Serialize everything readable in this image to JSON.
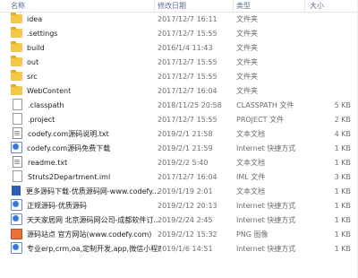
{
  "header": {
    "name": "名称",
    "date": "修改日期",
    "type": "类型",
    "size": "大小"
  },
  "files": [
    {
      "name": "idea",
      "date": "2017/12/7 16:11",
      "type": "文件夹",
      "size": "",
      "icon": "folder-icon"
    },
    {
      "name": ".settings",
      "date": "2017/12/7 15:55",
      "type": "文件夹",
      "size": "",
      "icon": "folder-icon"
    },
    {
      "name": "build",
      "date": "2016/1/4 11:43",
      "type": "文件夹",
      "size": "",
      "icon": "folder-icon"
    },
    {
      "name": "out",
      "date": "2017/12/7 15:55",
      "type": "文件夹",
      "size": "",
      "icon": "folder-icon"
    },
    {
      "name": "src",
      "date": "2017/12/7 15:55",
      "type": "文件夹",
      "size": "",
      "icon": "folder-icon"
    },
    {
      "name": "WebContent",
      "date": "2017/12/7 16:04",
      "type": "文件夹",
      "size": "",
      "icon": "folder-icon"
    },
    {
      "name": ".classpath",
      "date": "2018/11/25 20:58",
      "type": "CLASSPATH 文件",
      "size": "5 KB",
      "icon": "file-icon"
    },
    {
      "name": ".project",
      "date": "2017/12/7 15:55",
      "type": "PROJECT 文件",
      "size": "2 KB",
      "icon": "file-icon"
    },
    {
      "name": "codefy.com源码说明.txt",
      "date": "2019/2/1 21:58",
      "type": "文本文档",
      "size": "4 KB",
      "icon": "txt-icon"
    },
    {
      "name": "codefy.com源码免费下载",
      "date": "2019/2/1 21:59",
      "type": "Internet 快捷方式",
      "size": "1 KB",
      "icon": "web-icon"
    },
    {
      "name": "readme.txt",
      "date": "2019/2/2 5:40",
      "type": "文本文档",
      "size": "1 KB",
      "icon": "txt-icon"
    },
    {
      "name": "Struts2Department.iml",
      "date": "2017/12/7 16:04",
      "type": "IML 文件",
      "size": "3 KB",
      "icon": "file-icon"
    },
    {
      "name": "更多源码下载-优质源码网-www.codefy...",
      "date": "2019/1/19 2:01",
      "type": "文本文档",
      "size": "1 KB",
      "icon": "doc-icon"
    },
    {
      "name": "正规源码-优质源码",
      "date": "2019/2/12 20:13",
      "type": "Internet 快捷方式",
      "size": "1 KB",
      "icon": "web-icon"
    },
    {
      "name": "天天家居网 北京源码网公司-成都软件订...",
      "date": "2019/2/24 2:45",
      "type": "Internet 快捷方式",
      "size": "1 KB",
      "icon": "web-icon"
    },
    {
      "name": "源码站点 官方网站(www.codefy.com)",
      "date": "2019/2/12 15:32",
      "type": "PNG 图像",
      "size": "1 KB",
      "icon": "img-icon"
    },
    {
      "name": "专业erp,crm,oa,定制开发,app,微信小程序...",
      "date": "2019/1/6 14:51",
      "type": "Internet 快捷方式",
      "size": "1 KB",
      "icon": "web-icon"
    }
  ]
}
